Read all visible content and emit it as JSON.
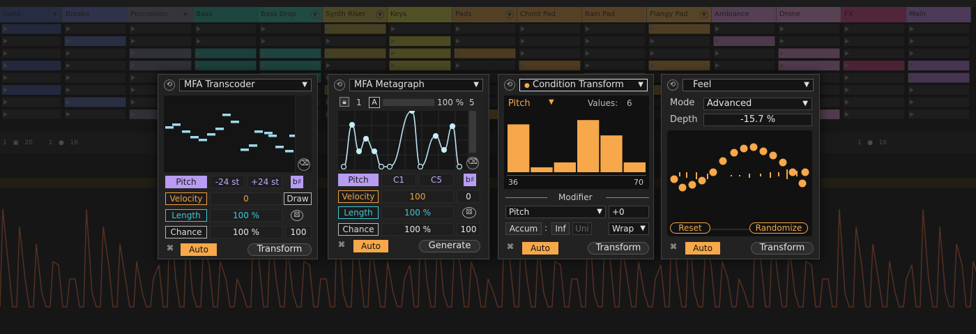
{
  "tracks": [
    {
      "name": "rums",
      "color": "#5b6aa0",
      "w": 90,
      "arrow": true
    },
    {
      "name": "Breaks",
      "color": "#6d78b0",
      "w": 93,
      "arrow": false
    },
    {
      "name": "Percussion",
      "color": "#7d7d90",
      "w": 94,
      "arrow": true
    },
    {
      "name": "Bass",
      "color": "#46a69a",
      "w": 93,
      "arrow": false
    },
    {
      "name": "Bass Drop",
      "color": "#4bb0a3",
      "w": 93,
      "arrow": true
    },
    {
      "name": "Synth Riser",
      "color": "#b8a85a",
      "w": 93,
      "arrow": true
    },
    {
      "name": "Keys",
      "color": "#c3c057",
      "w": 93,
      "arrow": false
    },
    {
      "name": "Pads",
      "color": "#c79a58",
      "w": 93,
      "arrow": true
    },
    {
      "name": "Chord Pad",
      "color": "#cf9b5a",
      "w": 93,
      "arrow": false
    },
    {
      "name": "Rain Pad",
      "color": "#cf9b5a",
      "w": 93,
      "arrow": false
    },
    {
      "name": "Flangy Pad",
      "color": "#d0a45c",
      "w": 93,
      "arrow": true
    },
    {
      "name": "Ambiance",
      "color": "#c995c8",
      "w": 93,
      "arrow": false
    },
    {
      "name": "Drone",
      "color": "#d39ac9",
      "w": 93,
      "arrow": false
    },
    {
      "name": "FX",
      "color": "#c45a8a",
      "w": 93,
      "arrow": false
    },
    {
      "name": "Main",
      "color": "#b58bd2",
      "w": 93,
      "arrow": false
    }
  ],
  "devices": {
    "transcoder": {
      "title": "MFA Transcoder",
      "rows": [
        {
          "label": "Pitch",
          "a": "-24 st",
          "b": "+24 st",
          "end": "b♯"
        },
        {
          "label": "Velocity",
          "a": "0",
          "end": "Draw"
        },
        {
          "label": "Length",
          "a": "100 %",
          "end": "dice"
        },
        {
          "label": "Chance",
          "a": "100 %",
          "end": "100"
        }
      ],
      "auto": "Auto",
      "action": "Transform"
    },
    "metagraph": {
      "title": "MFA Metagraph",
      "lock_num": "1",
      "a_label": "A",
      "percent": "100 %",
      "count": "5",
      "rows": [
        {
          "label": "Pitch",
          "a": "C1",
          "b": "C5",
          "end": "b♯"
        },
        {
          "label": "Velocity",
          "a": "100",
          "end": "0"
        },
        {
          "label": "Length",
          "a": "100 %",
          "end": "dice"
        },
        {
          "label": "Chance",
          "a": "100 %",
          "end": "100"
        }
      ],
      "auto": "Auto",
      "action": "Generate"
    },
    "condition": {
      "title": "Condition Transform",
      "param": "Pitch",
      "values_label": "Values:",
      "values_count": "6",
      "axis_min": "36",
      "axis_max": "70",
      "bars": [
        0.78,
        0.08,
        0.16,
        0.85,
        0.6,
        0.16
      ],
      "modifier_label": "Modifier",
      "mod_param": "Pitch",
      "mod_value": "+0",
      "accum": "Accum",
      "colon": ":",
      "inf": "Inf",
      "uni": "Uni",
      "wrap": "Wrap",
      "auto": "Auto",
      "action": "Transform"
    },
    "feel": {
      "title": "Feel",
      "mode_label": "Mode",
      "mode_value": "Advanced",
      "depth_label": "Depth",
      "depth_value": "-15.7 %",
      "reset": "Reset",
      "randomize": "Randomize",
      "auto": "Auto",
      "action": "Transform"
    }
  },
  "colors": {
    "orange": "#f6a84a",
    "purple": "#b79cf2",
    "cyan": "#3fc8d8",
    "note": "#9ed8ec"
  }
}
